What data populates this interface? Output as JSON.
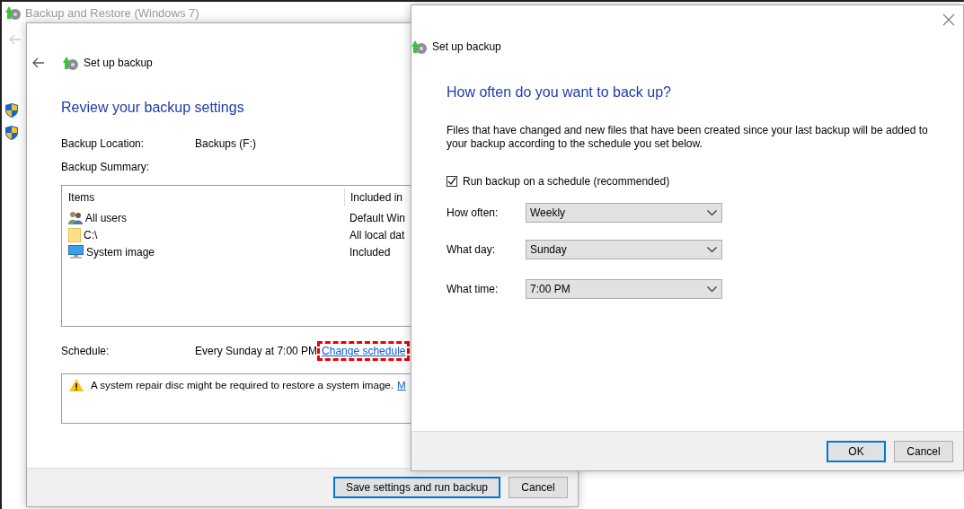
{
  "background_window": {
    "title": "Backup and Restore (Windows 7)"
  },
  "backup_dialog": {
    "title": "Set up backup",
    "heading": "Review your backup settings",
    "fields": [
      {
        "label": "Backup Location:",
        "value": "Backups (F:)"
      },
      {
        "label": "Backup Summary:"
      }
    ],
    "table": {
      "columns": [
        "Items",
        "Included in"
      ],
      "rows": [
        {
          "kind": "users",
          "item": "All users",
          "included": "Default Win"
        },
        {
          "kind": "folder",
          "item": "C:\\",
          "included": "All local dat"
        },
        {
          "kind": "monitor",
          "item": "System image",
          "included": "Included"
        }
      ]
    },
    "schedule": {
      "label": "Schedule:",
      "value": "Every Sunday at 7:00 PM",
      "link": "Change schedule",
      "highlighted": true
    },
    "warning": {
      "text": "A system repair disc might be required to restore a system image.",
      "link": "M"
    },
    "buttons": [
      {
        "label": "Save settings and run backup",
        "default": true
      },
      {
        "label": "Cancel",
        "default": false
      }
    ]
  },
  "schedule_dialog": {
    "title": "Set up backup",
    "heading": "How often do you want to back up?",
    "description": "Files that have changed and new files that have been created since your last backup will be added to your backup according to the schedule you set below.",
    "checkbox": {
      "label": "Run backup on a schedule (recommended)",
      "checked": true
    },
    "dropdowns": [
      {
        "label": "How often:",
        "value": "Weekly"
      },
      {
        "label": "What day:",
        "value": "Sunday"
      },
      {
        "label": "What time:",
        "value": "7:00 PM"
      }
    ],
    "buttons": [
      {
        "label": "OK",
        "default": true
      },
      {
        "label": "Cancel",
        "default": false
      }
    ]
  }
}
